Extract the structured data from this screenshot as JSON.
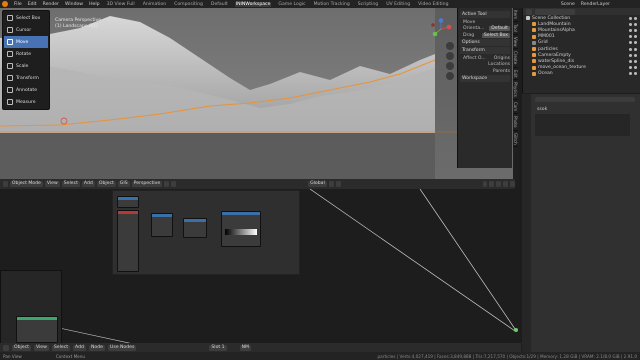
{
  "topbar": {
    "menus": [
      "File",
      "Edit",
      "Render",
      "Window",
      "Help"
    ],
    "workspaces": [
      "3D View Full",
      "Animation",
      "Compositing",
      "Default",
      "ININWorkspace",
      "Game Logic",
      "Motion Tracking",
      "Scripting",
      "UV Editing",
      "Video Editing"
    ],
    "active_workspace": "ININWorkspace",
    "scene_label": "Scene",
    "layer_label": "RenderLayer"
  },
  "toolbar": {
    "tools": [
      {
        "label": "Select Box",
        "active": false
      },
      {
        "label": "Cursor",
        "active": false
      },
      {
        "label": "Move",
        "active": true
      },
      {
        "label": "Rotate",
        "active": false
      },
      {
        "label": "Scale",
        "active": false
      },
      {
        "label": "Transform",
        "active": false
      },
      {
        "label": "Annotate",
        "active": false
      },
      {
        "label": "Measure",
        "active": false
      }
    ]
  },
  "viewport": {
    "info_line1": "Camera Perspective",
    "info_line2": "(1) Landscape.002",
    "header": {
      "mode": "Object Mode",
      "menus": [
        "View",
        "Select",
        "Add",
        "Object"
      ],
      "gis": "GIS",
      "view": "Perspective",
      "orientation": "Global"
    }
  },
  "npanel": {
    "active_tool": "Active Tool",
    "move": "Move",
    "orientation_label": "Orienta...",
    "orientation_value": "Default",
    "drag_label": "Drag",
    "drag_value": "Select Box",
    "options": "Options",
    "transform": "Transform",
    "affect_label": "Affect O...",
    "affect_items": [
      "Origins",
      "Locations",
      "Parents"
    ],
    "workspace": "Workspace",
    "tabs": [
      "Item",
      "Tool",
      "View",
      "Create",
      "Edit",
      "Physics",
      "Cam",
      "Photo",
      "Glitch"
    ]
  },
  "outliner": {
    "title": "Scene Collection",
    "items": [
      {
        "name": "Scene Collection",
        "color": "#c8c8c8",
        "sel": false
      },
      {
        "name": "LandMountain",
        "color": "#e49a3b",
        "sel": false
      },
      {
        "name": "MountainsAlpha",
        "color": "#e49a3b",
        "sel": false
      },
      {
        "name": "MM001",
        "color": "#e49a3b",
        "sel": false
      },
      {
        "name": "Grid",
        "color": "#888888",
        "sel": false
      },
      {
        "name": "particles",
        "color": "#e49a3b",
        "sel": false
      },
      {
        "name": "CameraEmpty",
        "color": "#e49a3b",
        "sel": false
      },
      {
        "name": "waterSpline_dis",
        "color": "#e49a3b",
        "sel": false
      },
      {
        "name": "move_ocean_texture",
        "color": "#e49a3b",
        "sel": false
      },
      {
        "name": "Ocean",
        "color": "#e49a3b",
        "sel": false
      }
    ]
  },
  "properties": {
    "search_placeholder": "",
    "material_label": "ssok"
  },
  "node_editor": {
    "mode": "Object",
    "menus": [
      "View",
      "Select",
      "Add",
      "Node"
    ],
    "use_nodes": "Use Nodes",
    "slot": "Slot 1",
    "material": "NM"
  },
  "statusbar": {
    "left1": "Pan View",
    "left2": "Context Menu",
    "right": "particles | Verts:4,027,419 | Faces:3,849,888 | Tris:7,217,570 | Objects:1/29 | Memory: 1.28 GiB | VRAM: 2.1/8.0 GiB | 2.91.0"
  }
}
